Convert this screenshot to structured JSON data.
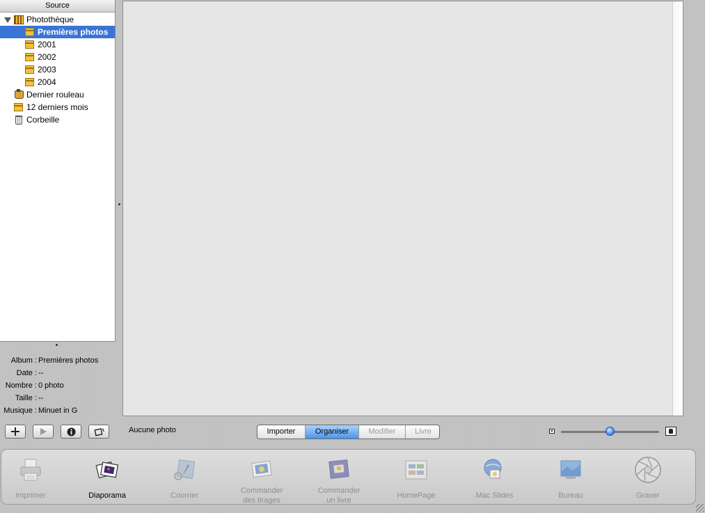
{
  "source": {
    "header": "Source",
    "items": [
      {
        "label": "Photothèque",
        "icon": "library-icon",
        "selected": false
      },
      {
        "label": "Premières photos",
        "icon": "calendar-icon",
        "selected": true
      },
      {
        "label": "2001",
        "icon": "calendar-icon",
        "selected": false
      },
      {
        "label": "2002",
        "icon": "calendar-icon",
        "selected": false
      },
      {
        "label": "2003",
        "icon": "calendar-icon",
        "selected": false
      },
      {
        "label": "2004",
        "icon": "calendar-icon",
        "selected": false
      },
      {
        "label": "Dernier rouleau",
        "icon": "film-roll-icon",
        "selected": false
      },
      {
        "label": "12 derniers mois",
        "icon": "calendar-icon",
        "selected": false
      },
      {
        "label": "Corbeille",
        "icon": "trash-icon",
        "selected": false
      }
    ]
  },
  "info": {
    "album_label": "Album :",
    "album_value": "Premières photos",
    "date_label": "Date :",
    "date_value": "--",
    "count_label": "Nombre :",
    "count_value": "0 photo",
    "size_label": "Taille :",
    "size_value": "--",
    "music_label": "Musique :",
    "music_value": "Minuet in G"
  },
  "controls": {
    "add_icon": "plus-icon",
    "play_icon": "play-icon",
    "info_icon": "info-icon",
    "rotate_icon": "rotate-icon",
    "status": "Aucune photo"
  },
  "modes": {
    "items": [
      {
        "label": "Importer",
        "state": "normal"
      },
      {
        "label": "Organiser",
        "state": "active"
      },
      {
        "label": "Modifier",
        "state": "disabled"
      },
      {
        "label": "Livre",
        "state": "disabled"
      }
    ]
  },
  "size_slider": {
    "value": 0.5
  },
  "toolbar": {
    "items": [
      {
        "label": "Imprimer",
        "icon": "printer-icon",
        "enabled": false
      },
      {
        "label": "Diaporama",
        "icon": "slideshow-icon",
        "enabled": true
      },
      {
        "label": "Courrier",
        "icon": "mail-icon",
        "enabled": false
      },
      {
        "label": "Commander\ndes tirages",
        "icon": "order-prints-icon",
        "enabled": false
      },
      {
        "label": "Commander\nun livre",
        "icon": "order-book-icon",
        "enabled": false
      },
      {
        "label": "HomePage",
        "icon": "homepage-icon",
        "enabled": false
      },
      {
        "label": ".Mac Slides",
        "icon": "mac-slides-icon",
        "enabled": false
      },
      {
        "label": "Bureau",
        "icon": "desktop-icon",
        "enabled": false
      },
      {
        "label": "Graver",
        "icon": "burn-icon",
        "enabled": false
      }
    ]
  },
  "colors": {
    "selection": "#3875d7",
    "segment_active": "#4b94ea",
    "photo_bg": "#e6e6e6"
  }
}
